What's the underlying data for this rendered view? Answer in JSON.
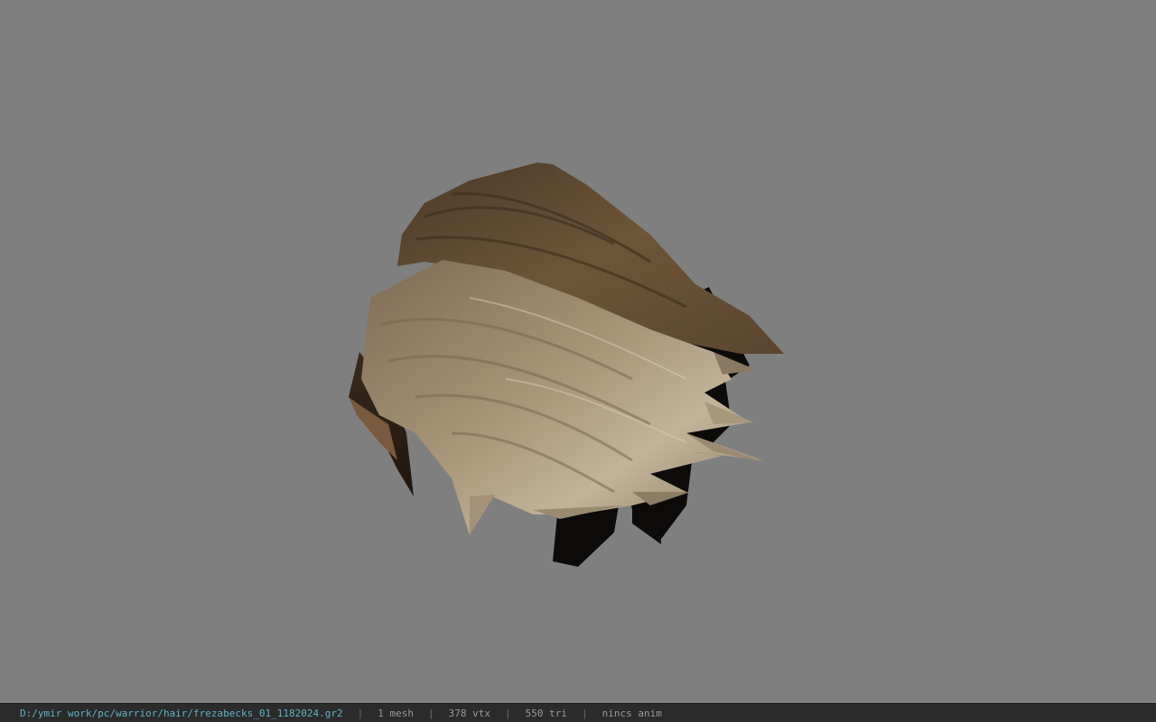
{
  "viewport": {
    "background_color": "#7f7f7f",
    "model_name": "hair-mesh"
  },
  "statusbar": {
    "path": "D:/ymir work/pc/warrior/hair/frezabecks_01_1182024.gr2",
    "separator": "|",
    "mesh_count": "1 mesh",
    "vertex_count": "378 vtx",
    "triangle_count": "550 tri",
    "anim_status": "nincs anim",
    "colors": {
      "path": "#5fb3c8",
      "text": "#9a9a9a",
      "background": "#2b2b2b"
    }
  }
}
